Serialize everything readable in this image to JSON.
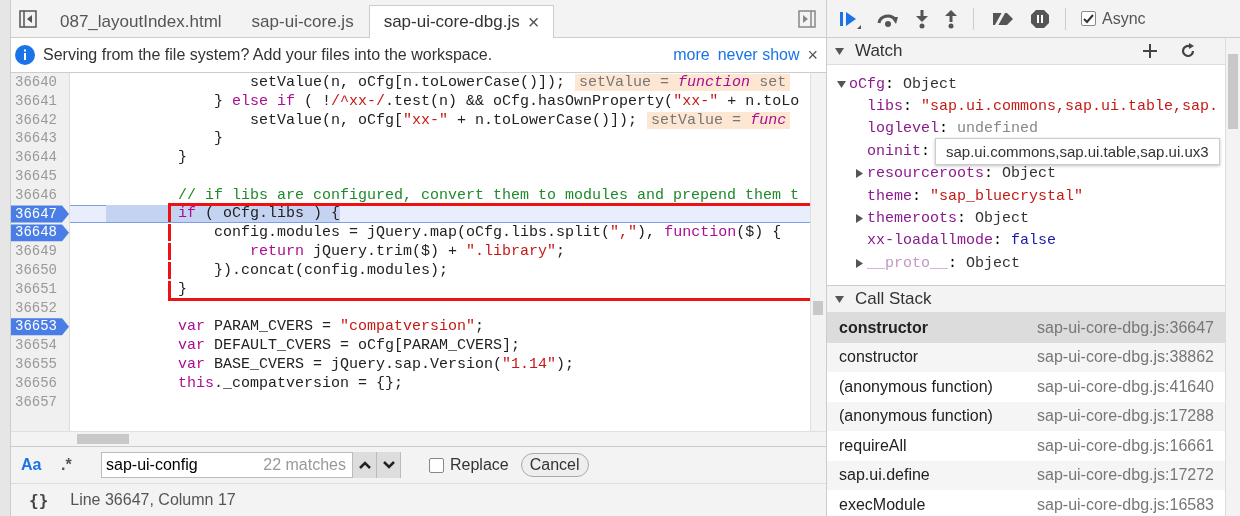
{
  "tabs": [
    {
      "label": "087_layoutIndex.html",
      "selected": false,
      "closable": false
    },
    {
      "label": "sap-ui-core.js",
      "selected": false,
      "closable": false
    },
    {
      "label": "sap-ui-core-dbg.js",
      "selected": true,
      "closable": true,
      "close": "×"
    }
  ],
  "infobar": {
    "message": "Serving from the file system? Add your files into the workspace.",
    "links": [
      "more",
      "never show"
    ],
    "close": "×"
  },
  "editor": {
    "lines": [
      {
        "number": "36640",
        "breakpoint": false,
        "current": false,
        "framed": false,
        "code": [
          {
            "kind": "plain",
            "text": "                setValue(n, oCfg[n.toLowerCase()]);"
          }
        ],
        "inline_value": [
          {
            "kind": "plain",
            "text": "setValue = "
          },
          {
            "kind": "italic-keyword",
            "text": "function"
          },
          {
            "kind": "plain",
            "text": " set"
          }
        ]
      },
      {
        "number": "36641",
        "breakpoint": false,
        "current": false,
        "framed": false,
        "code": [
          {
            "kind": "plain",
            "text": "            } "
          },
          {
            "kind": "keyword",
            "text": "else if"
          },
          {
            "kind": "plain",
            "text": " ( !"
          },
          {
            "kind": "regex",
            "text": "/^xx-/"
          },
          {
            "kind": "plain",
            "text": ".test(n) && oCfg.hasOwnProperty("
          },
          {
            "kind": "string",
            "text": "\"xx-\""
          },
          {
            "kind": "plain",
            "text": " + n.toLo"
          }
        ]
      },
      {
        "number": "36642",
        "breakpoint": false,
        "current": false,
        "framed": false,
        "code": [
          {
            "kind": "plain",
            "text": "                setValue(n, oCfg["
          },
          {
            "kind": "string",
            "text": "\"xx-\""
          },
          {
            "kind": "plain",
            "text": " + n.toLowerCase()]);"
          }
        ],
        "inline_value": [
          {
            "kind": "plain",
            "text": "setValue = "
          },
          {
            "kind": "italic-keyword",
            "text": "func"
          }
        ]
      },
      {
        "number": "36643",
        "breakpoint": false,
        "current": false,
        "framed": false,
        "code": [
          {
            "kind": "plain",
            "text": "            }"
          }
        ]
      },
      {
        "number": "36644",
        "breakpoint": false,
        "current": false,
        "framed": false,
        "code": [
          {
            "kind": "plain",
            "text": "        }"
          }
        ]
      },
      {
        "number": "36645",
        "breakpoint": false,
        "current": false,
        "framed": false
      },
      {
        "number": "36646",
        "breakpoint": false,
        "current": false,
        "framed": false,
        "code": [
          {
            "kind": "comment",
            "text": "        // if libs are configured, convert them to modules and prepend them t"
          }
        ]
      },
      {
        "number": "36647",
        "breakpoint": true,
        "current": true,
        "framed": true,
        "code": [
          {
            "kind": "keyword",
            "text": "        if"
          },
          {
            "kind": "plain",
            "text": " ( oCfg.libs ) {"
          }
        ]
      },
      {
        "number": "36648",
        "breakpoint": true,
        "current": false,
        "framed": true,
        "code": [
          {
            "kind": "plain",
            "text": "            config.modules = jQuery.map(oCfg.libs.split("
          },
          {
            "kind": "string",
            "text": "\",\""
          },
          {
            "kind": "plain",
            "text": "), "
          },
          {
            "kind": "keyword",
            "text": "function"
          },
          {
            "kind": "plain",
            "text": "($) {"
          }
        ]
      },
      {
        "number": "36649",
        "breakpoint": false,
        "current": false,
        "framed": true,
        "code": [
          {
            "kind": "keyword",
            "text": "                return"
          },
          {
            "kind": "plain",
            "text": " jQuery.trim($) + "
          },
          {
            "kind": "string",
            "text": "\".library\""
          },
          {
            "kind": "plain",
            "text": ";"
          }
        ]
      },
      {
        "number": "36650",
        "breakpoint": false,
        "current": false,
        "framed": true,
        "code": [
          {
            "kind": "plain",
            "text": "            }).concat(config.modules);"
          }
        ]
      },
      {
        "number": "36651",
        "breakpoint": false,
        "current": false,
        "framed": true,
        "code": [
          {
            "kind": "plain",
            "text": "        }"
          }
        ]
      },
      {
        "number": "36652",
        "breakpoint": false,
        "current": false,
        "framed": false
      },
      {
        "number": "36653",
        "breakpoint": true,
        "current": false,
        "framed": false,
        "code": [
          {
            "kind": "keyword",
            "text": "        var"
          },
          {
            "kind": "plain",
            "text": " PARAM_CVERS = "
          },
          {
            "kind": "string",
            "text": "\"compatversion\""
          },
          {
            "kind": "plain",
            "text": ";"
          }
        ]
      },
      {
        "number": "36654",
        "breakpoint": false,
        "current": false,
        "framed": false,
        "code": [
          {
            "kind": "keyword",
            "text": "        var"
          },
          {
            "kind": "plain",
            "text": " DEFAULT_CVERS = oCfg[PARAM_CVERS];"
          }
        ]
      },
      {
        "number": "36655",
        "breakpoint": false,
        "current": false,
        "framed": false,
        "code": [
          {
            "kind": "keyword",
            "text": "        var"
          },
          {
            "kind": "plain",
            "text": " BASE_CVERS = jQuery.sap.Version("
          },
          {
            "kind": "string",
            "text": "\"1.14\""
          },
          {
            "kind": "plain",
            "text": ");"
          }
        ]
      },
      {
        "number": "36656",
        "breakpoint": false,
        "current": false,
        "framed": false,
        "code": [
          {
            "kind": "keyword",
            "text": "        this"
          },
          {
            "kind": "plain",
            "text": "._compatversion = {};"
          }
        ]
      },
      {
        "number": "36657",
        "breakpoint": false,
        "current": false,
        "framed": false
      }
    ]
  },
  "search": {
    "match_case": {
      "label": "Aa",
      "on": true
    },
    "regex": {
      "label": ".*",
      "on": false
    },
    "value": "sap-ui-config",
    "count": "22 matches",
    "replace": {
      "label": "Replace",
      "checked": false
    },
    "cancel": "Cancel"
  },
  "status": {
    "format": "{}",
    "position": "Line 36647, Column 17"
  },
  "debugger": {
    "async": {
      "label": "Async",
      "checked": true
    },
    "watch": {
      "title": "Watch",
      "expanded": true,
      "items": [
        {
          "name": "oCfg",
          "sep": ":",
          "value": "Object",
          "kind": "object",
          "expanded": true,
          "children": [
            {
              "name": "libs",
              "sep": ":",
              "value": "\"sap.ui.commons,sap.ui.table,sap.",
              "kind": "string"
            },
            {
              "name": "loglevel",
              "sep": ":",
              "value": "undefined",
              "kind": "undefined"
            },
            {
              "name": "oninit",
              "sep": ":"
            },
            {
              "name": "resourceroots",
              "sep": ":",
              "value": "Object",
              "kind": "object",
              "expanded": false
            },
            {
              "name": "theme",
              "sep": ":",
              "value": "\"sap_bluecrystal\"",
              "kind": "string"
            },
            {
              "name": "themeroots",
              "sep": ":",
              "value": "Object",
              "kind": "object",
              "expanded": false
            },
            {
              "name": "xx-loadallmode",
              "sep": ":",
              "value": "false",
              "kind": "boolean"
            },
            {
              "name": "__proto__",
              "sep": ":",
              "value": "Object",
              "kind": "object",
              "expanded": false,
              "dim": true
            }
          ]
        }
      ]
    },
    "tooltip": "sap.ui.commons,sap.ui.table,sap.ui.ux3",
    "call_stack": {
      "title": "Call Stack",
      "expanded": true,
      "frames": [
        {
          "function": "constructor",
          "location": "sap-ui-core-dbg.js:36647",
          "selected": true
        },
        {
          "function": "constructor",
          "location": "sap-ui-core-dbg.js:38862",
          "selected": false
        },
        {
          "function": "(anonymous function)",
          "location": "sap-ui-core-dbg.js:41640",
          "selected": false
        },
        {
          "function": "(anonymous function)",
          "location": "sap-ui-core-dbg.js:17288",
          "selected": false
        },
        {
          "function": "requireAll",
          "location": "sap-ui-core-dbg.js:16661",
          "selected": false
        },
        {
          "function": "sap.ui.define",
          "location": "sap-ui-core-dbg.js:17272",
          "selected": false
        },
        {
          "function": "execModule",
          "location": "sap-ui-core-dbg.js:16583",
          "selected": false
        }
      ]
    }
  }
}
